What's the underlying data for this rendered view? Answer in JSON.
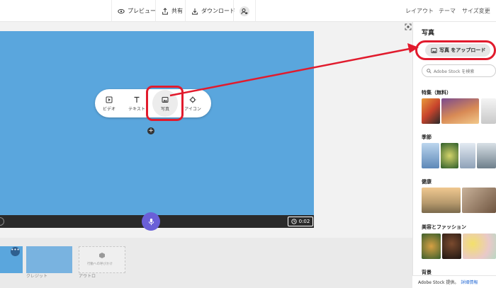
{
  "toolbar": {
    "preview_label": "プレビュー",
    "share_label": "共有",
    "download_label": "ダウンロード",
    "layout_label": "レイアウト",
    "theme_label": "テーマ",
    "size_label": "サイズ変更"
  },
  "insert_menu": {
    "video_label": "ビデオ",
    "text_label": "テキスト",
    "photo_label": "写真",
    "icon_label": "アイコン"
  },
  "player": {
    "time": "0:02"
  },
  "thumbnails": {
    "credit_label": "クレジット",
    "outro_label": "アウトロ",
    "outro_placeholder": "行動への呼びかけ"
  },
  "panel": {
    "title": "写真",
    "upload_label": "写真 をアップロード",
    "search_placeholder": "Adobe Stock を検索",
    "sections": {
      "featured": "特集（無料）",
      "seasons": "季節",
      "health": "健康",
      "beauty_fashion": "美容とファッション",
      "background": "背景"
    },
    "footer_text": "Adobe Stock 提供。",
    "footer_link": "詳細情報"
  },
  "colors": {
    "accent": "#6a5fd8",
    "slide": "#5aa6dd",
    "highlight": "#e11b2d",
    "link": "#2d6fd6"
  }
}
